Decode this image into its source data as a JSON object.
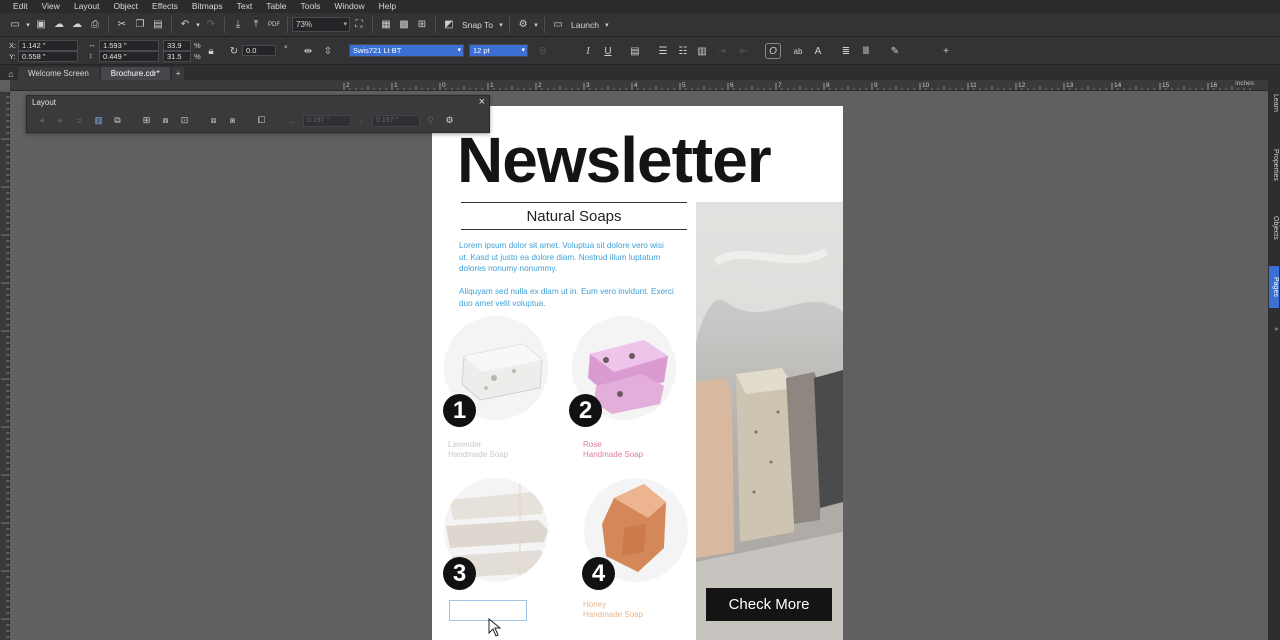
{
  "menu": [
    "Edit",
    "View",
    "Layout",
    "Object",
    "Effects",
    "Bitmaps",
    "Text",
    "Table",
    "Tools",
    "Window",
    "Help"
  ],
  "toolbar": {
    "zoom": "73%",
    "snap_to": "Snap To",
    "launch": "Launch"
  },
  "propbar": {
    "x_label": "X:",
    "y_label": "Y:",
    "x_value": "1.142 \"",
    "y_value": "0.558 \"",
    "w_value": "1.593 \"",
    "h_value": "0.449 \"",
    "scale_w": "33.9",
    "scale_h": "31.5",
    "percent": "%",
    "rotation": "0.0",
    "degree": "°",
    "font_name": "Swis721 Lt BT",
    "font_size": "12 pt"
  },
  "tabs": {
    "welcome": "Welcome Screen",
    "brochure": "Brochure.cdr*",
    "add": "+"
  },
  "ruler": {
    "unit": "inches",
    "ticks": [
      "2",
      "1",
      "0",
      "1",
      "2",
      "3",
      "4",
      "5",
      "6",
      "7",
      "8",
      "9",
      "10",
      "11",
      "12",
      "13",
      "14",
      "15",
      "16"
    ]
  },
  "docker": {
    "learn": "Learn",
    "properties": "Properties",
    "objects": "Objects",
    "pages": "Pages"
  },
  "layout_bar": {
    "title": "Layout",
    "field1": "0.197 \"",
    "field2": "0.197 \""
  },
  "page": {
    "headline": "Newsletter",
    "subtitle": "Natural Soaps",
    "para1": "Lorem ipsum dolor sit amet. Voluptua sit dolore vero wisi ut. Kasd ut justo ea dolore diam. Nostrud illum luptatum dolores nonumy nonummy.",
    "para2": "Aliquyam sed nulla ex diam ut in. Eum vero invidunt. Exerci duo amet velit voluptua.",
    "badges": [
      "1",
      "2",
      "3",
      "4"
    ],
    "products": [
      {
        "line1": "Lavender",
        "line2": "Handmade Soap",
        "color": "#c9c9cb"
      },
      {
        "line1": "Rose",
        "line2": "Handmade Soap",
        "color": "#e07aa6"
      },
      {
        "line1": "",
        "line2": "",
        "color": "#c9c9cb"
      },
      {
        "line1": "Honey",
        "line2": "Handmade Soap",
        "color": "#e8b98f"
      }
    ],
    "cta": "Check More"
  },
  "colors": {
    "accent_blue": "#3b6fd4",
    "body_text": "#3ea1d6"
  }
}
